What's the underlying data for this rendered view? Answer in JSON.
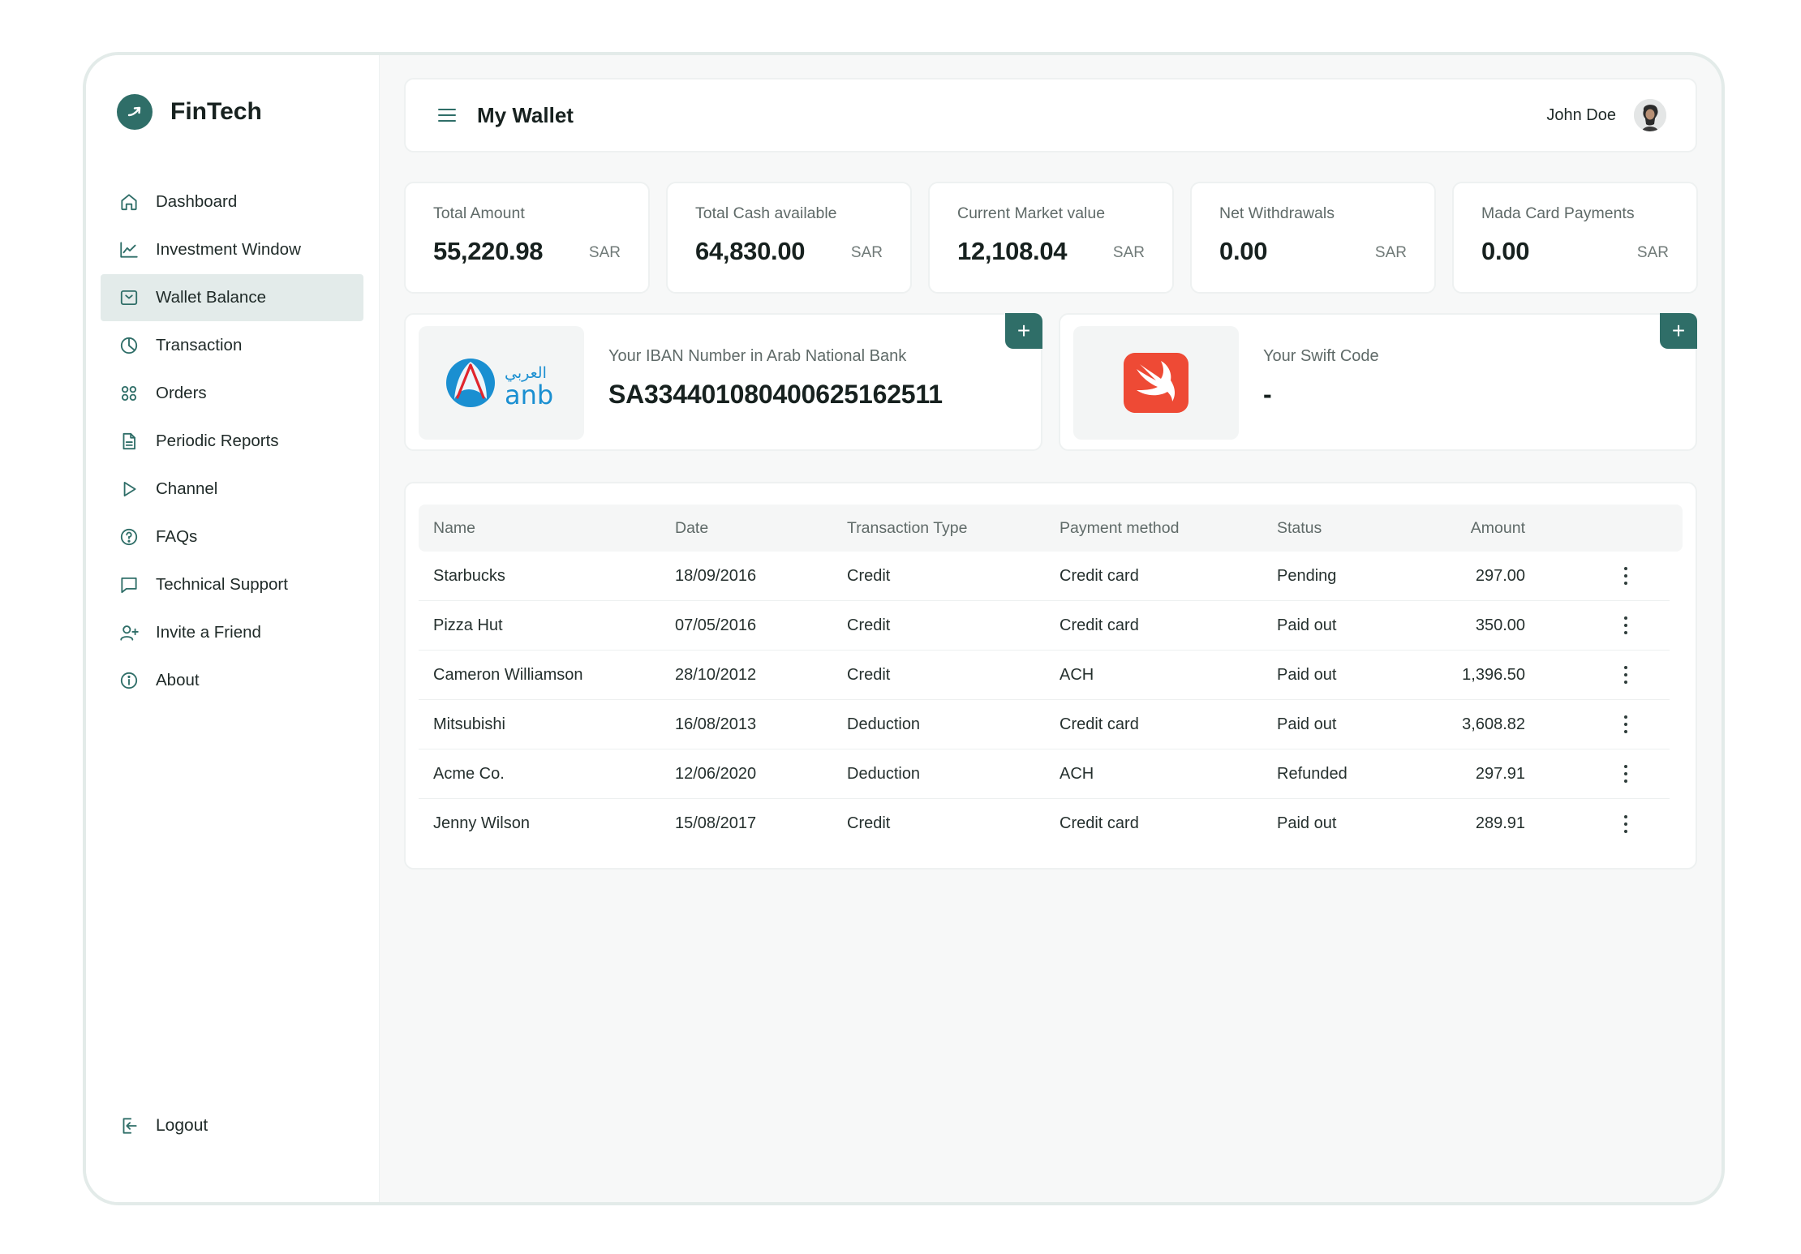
{
  "brand": {
    "name": "FinTech"
  },
  "sidebar": {
    "items": [
      {
        "label": "Dashboard",
        "icon": "home-icon"
      },
      {
        "label": "Investment Window",
        "icon": "chart-line-icon"
      },
      {
        "label": "Wallet Balance",
        "icon": "wallet-icon",
        "active": true
      },
      {
        "label": "Transaction",
        "icon": "pie-chart-icon"
      },
      {
        "label": "Orders",
        "icon": "grid-icon"
      },
      {
        "label": "Periodic Reports",
        "icon": "document-icon"
      },
      {
        "label": "Channel",
        "icon": "play-icon"
      },
      {
        "label": "FAQs",
        "icon": "help-icon"
      },
      {
        "label": "Technical Support",
        "icon": "chat-icon"
      },
      {
        "label": "Invite a Friend",
        "icon": "user-add-icon"
      },
      {
        "label": "About",
        "icon": "info-icon"
      }
    ],
    "logout_label": "Logout"
  },
  "header": {
    "title": "My Wallet",
    "user_name": "John Doe"
  },
  "stats": [
    {
      "label": "Total Amount",
      "value": "55,220.98",
      "unit": "SAR"
    },
    {
      "label": "Total Cash available",
      "value": "64,830.00",
      "unit": "SAR"
    },
    {
      "label": "Current Market value",
      "value": "12,108.04",
      "unit": "SAR"
    },
    {
      "label": "Net Withdrawals",
      "value": "0.00",
      "unit": "SAR"
    },
    {
      "label": "Mada Card Payments",
      "value": "0.00",
      "unit": "SAR"
    }
  ],
  "bank": {
    "iban_label": "Your IBAN Number in Arab National Bank",
    "iban_value": "SA3344010804006251625​11",
    "logo_text_ar": "العربي",
    "logo_text_en": "anb",
    "swift_label": "Your Swift Code",
    "swift_value": "-",
    "add_symbol": "+"
  },
  "table": {
    "headers": [
      "Name",
      "Date",
      "Transaction Type",
      "Payment method",
      "Status",
      "Amount"
    ],
    "rows": [
      [
        "Starbucks",
        "18/09/2016",
        "Credit",
        "Credit card",
        "Pending",
        "297.00"
      ],
      [
        "Pizza Hut",
        "07/05/2016",
        "Credit",
        "Credit card",
        "Paid out",
        "350.00"
      ],
      [
        "Cameron Williamson",
        "28/10/2012",
        "Credit",
        "ACH",
        "Paid out",
        "1,396.50"
      ],
      [
        "Mitsubishi",
        "16/08/2013",
        "Deduction",
        "Credit card",
        "Paid out",
        "3,608.82"
      ],
      [
        "Acme Co.",
        "12/06/2020",
        "Deduction",
        "ACH",
        "Refunded",
        "297.91"
      ],
      [
        "Jenny Wilson",
        "15/08/2017",
        "Credit",
        "Credit card",
        "Paid out",
        "289.91"
      ]
    ]
  },
  "colors": {
    "accent": "#2f6e68",
    "swift": "#ee4a35",
    "anb_blue": "#1a8fd1"
  }
}
